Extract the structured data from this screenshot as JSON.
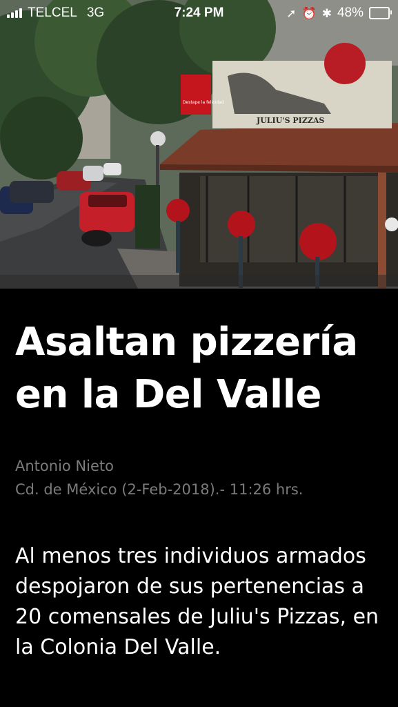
{
  "status_bar": {
    "carrier": "TELCEL",
    "network": "3G",
    "time": "7:24 PM",
    "battery_percent": "48%",
    "battery_level": 0.48,
    "icons": [
      "signal-icon",
      "location-arrow-icon",
      "alarm-icon",
      "bluetooth-icon",
      "battery-icon"
    ]
  },
  "hero_image": {
    "sign_text": "JULIU'S PIZZAS",
    "cocacola_sign_text": "Destape la felicidad"
  },
  "article": {
    "headline": "Asaltan pizzería en la Del Valle",
    "author": "Antonio Nieto",
    "dateline": "Cd. de México (2-Feb-2018).- 11:26 hrs.",
    "body": "Al menos tres individuos armados despojaron de sus pertenencias a 20 comensales de Juliu's Pizzas, en la Colonia Del Valle."
  },
  "colors": {
    "background": "#000000",
    "text_primary": "#ffffff",
    "text_secondary": "#7b7b7b"
  }
}
